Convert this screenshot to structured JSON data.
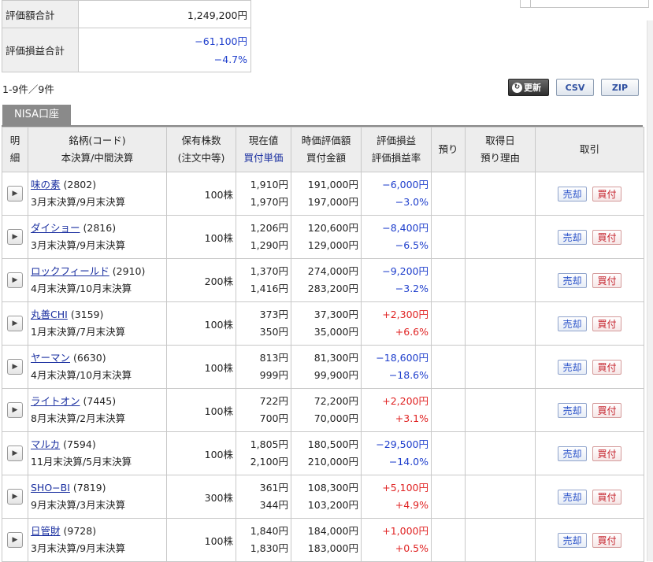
{
  "summary": {
    "valuation_label": "評価額合計",
    "valuation_value": "1,249,200円",
    "pl_label": "評価損益合計",
    "pl_value": "−61,100円",
    "pl_rate": "−4.7%"
  },
  "count_text": "1-9件／9件",
  "toolbar": {
    "update_label": "更新",
    "csv_label": "CSV",
    "zip_label": "ZIP"
  },
  "tab_label": "NISA口座",
  "headers": {
    "detail": [
      "明",
      "細"
    ],
    "stock": [
      "銘柄(コード)",
      "本決算/中間決算"
    ],
    "shares": [
      "保有株数",
      "(注文中等)"
    ],
    "price": [
      "現在値",
      "買付単価"
    ],
    "value": [
      "時価評価額",
      "買付金額"
    ],
    "pl": [
      "評価損益",
      "評価損益率"
    ],
    "deposit": "預り",
    "acquired": [
      "取得日",
      "預り理由"
    ],
    "trade": "取引"
  },
  "action_labels": {
    "sell": "売却",
    "buy": "買付"
  },
  "rows": [
    {
      "name": "味の素",
      "code": "(2802)",
      "period": "3月末決算/9月末決算",
      "shares": "100株",
      "price": "1,910円",
      "unit": "1,970円",
      "value": "191,000円",
      "cost": "197,000円",
      "pl": "−6,000円",
      "rate": "−3.0%",
      "sign": "neg"
    },
    {
      "name": "ダイショー",
      "code": "(2816)",
      "period": "3月末決算/9月末決算",
      "shares": "100株",
      "price": "1,206円",
      "unit": "1,290円",
      "value": "120,600円",
      "cost": "129,000円",
      "pl": "−8,400円",
      "rate": "−6.5%",
      "sign": "neg"
    },
    {
      "name": "ロックフィールド",
      "code": "(2910)",
      "period": "4月末決算/10月末決算",
      "shares": "200株",
      "price": "1,370円",
      "unit": "1,416円",
      "value": "274,000円",
      "cost": "283,200円",
      "pl": "−9,200円",
      "rate": "−3.2%",
      "sign": "neg"
    },
    {
      "name": "丸善CHI",
      "code": "(3159)",
      "period": "1月末決算/7月末決算",
      "shares": "100株",
      "price": "373円",
      "unit": "350円",
      "value": "37,300円",
      "cost": "35,000円",
      "pl": "+2,300円",
      "rate": "+6.6%",
      "sign": "pos"
    },
    {
      "name": "ヤーマン",
      "code": "(6630)",
      "period": "4月末決算/10月末決算",
      "shares": "100株",
      "price": "813円",
      "unit": "999円",
      "value": "81,300円",
      "cost": "99,900円",
      "pl": "−18,600円",
      "rate": "−18.6%",
      "sign": "neg"
    },
    {
      "name": "ライトオン",
      "code": "(7445)",
      "period": "8月末決算/2月末決算",
      "shares": "100株",
      "price": "722円",
      "unit": "700円",
      "value": "72,200円",
      "cost": "70,000円",
      "pl": "+2,200円",
      "rate": "+3.1%",
      "sign": "pos"
    },
    {
      "name": "マルカ",
      "code": "(7594)",
      "period": "11月末決算/5月末決算",
      "shares": "100株",
      "price": "1,805円",
      "unit": "2,100円",
      "value": "180,500円",
      "cost": "210,000円",
      "pl": "−29,500円",
      "rate": "−14.0%",
      "sign": "neg"
    },
    {
      "name": "SHO−BI",
      "code": "(7819)",
      "period": "9月末決算/3月末決算",
      "shares": "300株",
      "price": "361円",
      "unit": "344円",
      "value": "108,300円",
      "cost": "103,200円",
      "pl": "+5,100円",
      "rate": "+4.9%",
      "sign": "pos"
    },
    {
      "name": "日管財",
      "code": "(9728)",
      "period": "3月末決算/9月末決算",
      "shares": "100株",
      "price": "1,840円",
      "unit": "1,830円",
      "value": "184,000円",
      "cost": "183,000円",
      "pl": "+1,000円",
      "rate": "+0.5%",
      "sign": "pos"
    }
  ],
  "colors": {
    "negative": "#1e3ecc",
    "positive": "#e02323",
    "link": "#1a2fa0"
  }
}
